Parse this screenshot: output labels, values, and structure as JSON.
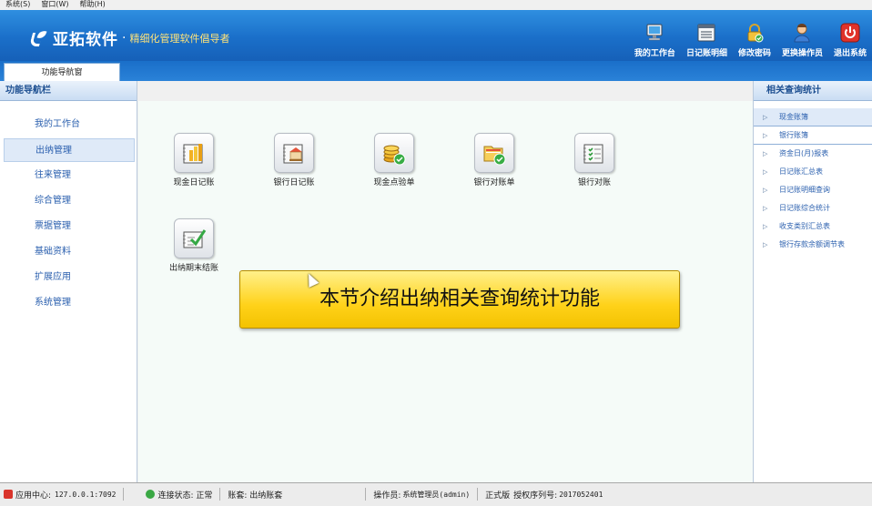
{
  "menubar": {
    "items": [
      "系统(S)",
      "窗口(W)",
      "帮助(H)"
    ]
  },
  "header": {
    "brand": "亚拓软件",
    "slogan": "精细化管理软件倡导者",
    "buttons": [
      {
        "label": "我的工作台",
        "icon": "monitor-icon"
      },
      {
        "label": "日记账明细",
        "icon": "ledger-icon"
      },
      {
        "label": "修改密码",
        "icon": "lock-icon"
      },
      {
        "label": "更换操作员",
        "icon": "user-icon"
      },
      {
        "label": "退出系统",
        "icon": "power-icon"
      }
    ]
  },
  "tabs": [
    {
      "label": "功能导航窗"
    }
  ],
  "left": {
    "title": "功能导航栏",
    "items": [
      {
        "label": "我的工作台"
      },
      {
        "label": "出纳管理",
        "active": true
      },
      {
        "label": "往来管理"
      },
      {
        "label": "综合管理"
      },
      {
        "label": "票据管理"
      },
      {
        "label": "基础资料"
      },
      {
        "label": "扩展应用"
      },
      {
        "label": "系统管理"
      }
    ]
  },
  "center": {
    "tiles": [
      {
        "label": "现金日记账",
        "icon": "cash-journal-icon"
      },
      {
        "label": "银行日记账",
        "icon": "bank-journal-icon"
      },
      {
        "label": "现金点验单",
        "icon": "coin-check-icon"
      },
      {
        "label": "银行对账单",
        "icon": "bank-statement-icon"
      },
      {
        "label": "银行对账",
        "icon": "reconcile-icon"
      },
      {
        "label": "出纳期末结账",
        "icon": "period-close-icon"
      }
    ],
    "banner": "本节介绍出纳相关查询统计功能"
  },
  "right": {
    "title": "相关查询统计",
    "items": [
      {
        "label": "现金账簿",
        "active": true
      },
      {
        "label": "银行账簿"
      },
      {
        "label": "资金日(月)报表"
      },
      {
        "label": "日记账汇总表"
      },
      {
        "label": "日记账明细查询"
      },
      {
        "label": "日记账综合统计"
      },
      {
        "label": "收支类别汇总表"
      },
      {
        "label": "银行存款余额调节表"
      }
    ]
  },
  "status": {
    "app_center_label": "应用中心:",
    "app_center_value": "127.0.0.1:7092",
    "connection": "连接状态: 正常",
    "account_set": "账套: 出纳账套",
    "operator_label": "操作员:",
    "operator_value": "系统管理员(admin)",
    "edition": "正式版",
    "license_label": "授权序列号:",
    "license_value": "2017052401"
  },
  "colors": {
    "header_blue": "#1a6fc9",
    "banner_yellow": "#ffd21a",
    "nav_text": "#2a5fae"
  }
}
